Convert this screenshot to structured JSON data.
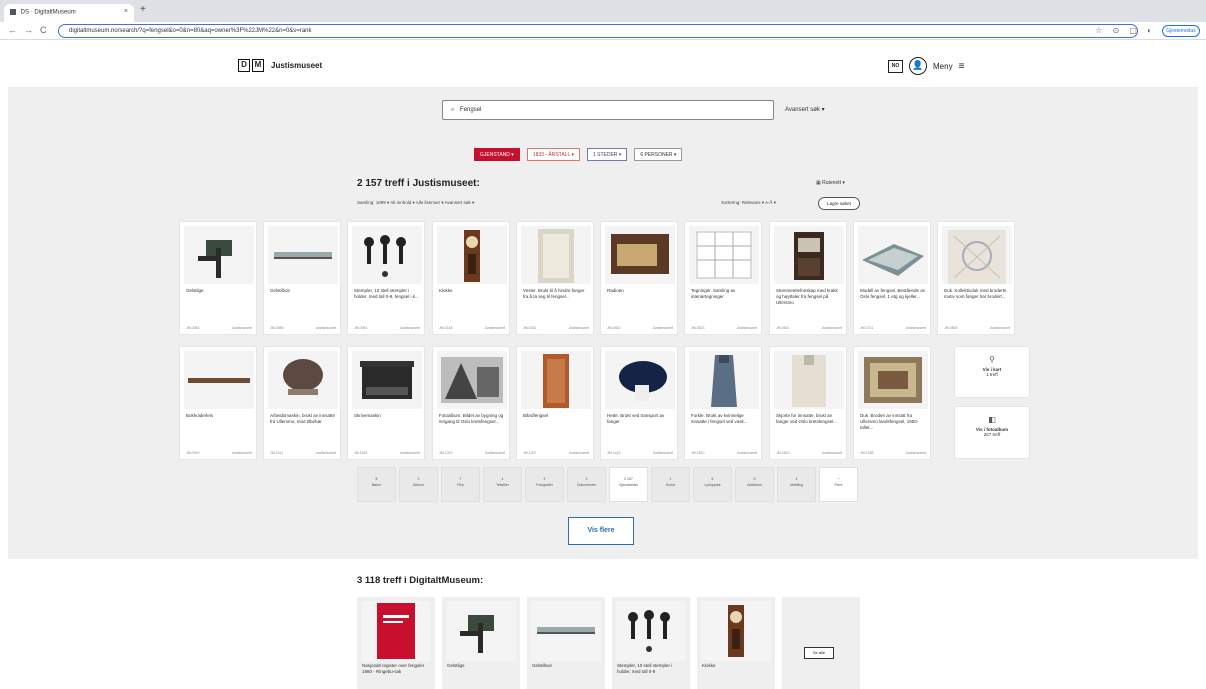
{
  "browser": {
    "tab_title": "DS · DigitaltMuseum",
    "tab_close": "×",
    "new_tab": "+",
    "nav": {
      "back": "←",
      "forward": "→",
      "reload": "C"
    },
    "url": "digitaltmuseum.no/search/?q=fengsel&o=0&n=80&aq=owner%3F%22JM%22&n=0&s=rank",
    "profile_label": "Gjestemodus"
  },
  "header": {
    "logo_letters": [
      "D",
      "M"
    ],
    "logo_text": "Justismuseet",
    "lang": "NO",
    "user_icon": "person-icon",
    "menu_label": "Meny",
    "menu_icon": "≡"
  },
  "search": {
    "icon": "🔍",
    "query": "Fengsel",
    "advanced": "Avansert søk ▾"
  },
  "filters": [
    {
      "label": "GJENSTAND ▾",
      "state": "active"
    },
    {
      "label": "1833 - ÅRSTALL ▾",
      "state": "red"
    },
    {
      "label": "1 STEDER ▾",
      "state": "blue"
    },
    {
      "label": "6 PERSONER ▾",
      "state": "default"
    }
  ],
  "results": {
    "title": "2 157 treff i Justismuseet:",
    "list_toggle": "▦ Rutenett ▾",
    "sort_left": "Samling: 1899 ▾   Alt innhold ▾   Alle lisenser ▾   Avansert søk ▾",
    "sort_right": "Sortering: Relevans ▾   A-Å ▾",
    "clear": "Lagre søket"
  },
  "cards_row1": [
    {
      "caption": "Gelstilge",
      "meta_left": "JM.0082",
      "meta_right": "Justismuseet"
    },
    {
      "caption": "Gelstilboir",
      "meta_left": "JM.0085",
      "meta_right": "Justismuseet"
    },
    {
      "caption": "Stempler, 10 stell stempler i holder, med tall 0-9, fengsel i k...",
      "meta_left": "JM.0051",
      "meta_right": "Justismuseet"
    },
    {
      "caption": "Klokke",
      "meta_left": "JM.0148",
      "meta_right": "Justismuseet"
    },
    {
      "caption": "Vester. Brukt til å hindre fanger fra å ta seg til fengsel...",
      "meta_left": "JM.0331",
      "meta_right": "Justismuseet"
    },
    {
      "caption": "Radioen",
      "meta_left": "JM.0452",
      "meta_right": "Justismuseet"
    },
    {
      "caption": "Tegninger. Samling av interiørtegninger",
      "meta_left": "JM.0523",
      "meta_right": "Justismuseet"
    },
    {
      "caption": "Stemmetelefonskap med krakk og høyttaler fra fengsel på Ullersmo",
      "meta_left": "JM.0601",
      "meta_right": "Justismuseet"
    },
    {
      "caption": "Modell av fengsel. Bestående av Oslo fengsel, 1 etg og kjeller...",
      "meta_left": "JM.0711",
      "meta_right": "Justismuseet"
    },
    {
      "caption": "Duk. Kollektivduk med broderte motiv som fanger har brodert...",
      "meta_left": "JM.0805",
      "meta_right": "Justismuseet"
    }
  ],
  "cards_row2": [
    {
      "caption": "Bokhoiderleis",
      "meta_left": "JM.0919",
      "meta_right": "Justismuseet"
    },
    {
      "caption": "Arbeidsmaskin, brukt av innsatte fra Ullersmo, med tilbehør",
      "meta_left": "JM.1011",
      "meta_right": "Justismuseet"
    },
    {
      "caption": "Skrivemaskin",
      "meta_left": "JM.1109",
      "meta_right": "Justismuseet"
    },
    {
      "caption": "Fotoalbum. Bildet av bygning og inngang til Oslo kretsfengsel...",
      "meta_left": "JM.1202",
      "meta_right": "Justismuseet"
    },
    {
      "caption": "Båndfengsel",
      "meta_left": "JM.1307",
      "meta_right": "Justismuseet"
    },
    {
      "caption": "Hette. Brukt ved transport av fanger",
      "meta_left": "JM.1415",
      "meta_right": "Justismuseet"
    },
    {
      "caption": "Forkle. Brukt av kvinnelige innsatte i fengsel ved vask...",
      "meta_left": "JM.1520",
      "meta_right": "Justismuseet"
    },
    {
      "caption": "Skjorte for innsatte, brukt av fanger ved Oslo kretsfengsel...",
      "meta_left": "JM.1623",
      "meta_right": "Justismuseet"
    },
    {
      "caption": "Duk. Broderi av innsatt fra Ullersmo landsfengsel, 1950-tallet...",
      "meta_left": "JM.1788",
      "meta_right": "Justismuseet"
    }
  ],
  "side_cards": [
    {
      "icon": "map-pin-icon",
      "glyph": "⚲",
      "title": "Vis i kart",
      "sub": "1 treff"
    },
    {
      "icon": "gallery-icon",
      "glyph": "◧",
      "title": "Vis i fotoalbum",
      "sub": "267 treff"
    }
  ],
  "types": [
    {
      "count": "8",
      "label": "Bøker"
    },
    {
      "count": "2",
      "label": "Arkiver"
    },
    {
      "count": "7",
      "label": "Film"
    },
    {
      "count": "4",
      "label": "Tekstiler"
    },
    {
      "count": "9",
      "label": "Fotografier"
    },
    {
      "count": "3",
      "label": "Dokumenter"
    },
    {
      "count": "2 157",
      "label": "Gjenstander"
    },
    {
      "count": "1",
      "label": "Kunst"
    },
    {
      "count": "6",
      "label": "Lydopptak"
    },
    {
      "count": "5",
      "label": "Arkitektur"
    },
    {
      "count": "4",
      "label": "Utstilling"
    },
    {
      "count": "···",
      "label": "Flere"
    }
  ],
  "vis_flere": "Vis flere",
  "digitaltmuseum": {
    "title": "3 118 treff i DigitaltMuseum:",
    "cards": [
      {
        "caption": "Nasjonalt register over fengsler 1980 - Ringebu-sak"
      },
      {
        "caption": "Gelstilge"
      },
      {
        "caption": "Gelstilboir"
      },
      {
        "caption": "Stempler, 10 stell stempler i holder, med tall 0-9"
      },
      {
        "caption": "Klokke"
      }
    ],
    "all_label": "Se alle"
  },
  "colors": {
    "accent_red": "#c8102e",
    "link_blue": "#2d6ea8",
    "section_grey": "#efefef"
  }
}
